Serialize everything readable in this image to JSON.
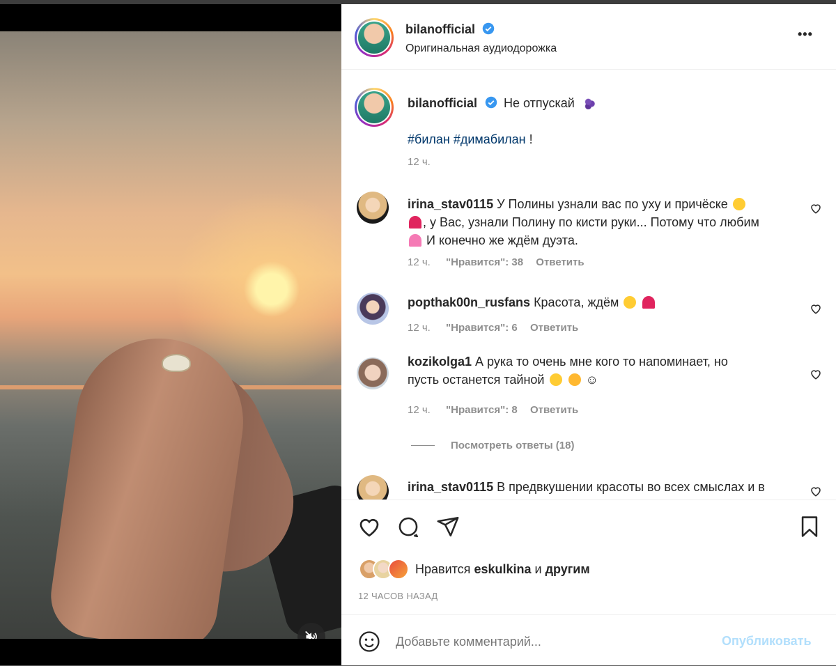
{
  "post": {
    "username": "bilanofficial",
    "audio_label": "Оригинальная аудиодорожка",
    "more_label": "•••"
  },
  "caption": {
    "username": "bilanofficial",
    "text": "Не отпускай",
    "hashtags": "#билан #димабилан",
    "suffix": " !",
    "time": "12 ч."
  },
  "comments": [
    {
      "username": "irina_stav0115",
      "text_part1": "У Полины узнали вас по уху и причёске",
      "text_part2": ", у Вас, узнали Полину по кисти руки... Потому что любим",
      "text_part3": "И конечно же ждём дуэта.",
      "time": "12 ч.",
      "likes": "\"Нравится\": 38",
      "reply": "Ответить"
    },
    {
      "username": "popthak00n_rusfans",
      "text": "Красота, ждём",
      "time": "12 ч.",
      "likes": "\"Нравится\": 6",
      "reply": "Ответить"
    },
    {
      "username": "kozikolga1",
      "text_part1": "А рука то очень мне кого то напоминает, но",
      "text_part2": "пусть останется тайной",
      "text_part3": "☺",
      "time": "12 ч.",
      "likes": "\"Нравится\": 8",
      "reply": "Ответить"
    },
    {
      "username": "irina_stav0115",
      "text": "В предвкушении красоты во всех смыслах и в"
    }
  ],
  "view_replies": "Посмотреть ответы (18)",
  "likes_line": {
    "prefix": "Нравится",
    "user": "eskulkina",
    "and": "и",
    "others": "другим"
  },
  "timestamp": "12 ЧАСОВ НАЗАД",
  "comment_input": {
    "placeholder": "Добавьте комментарий...",
    "publish_label": "Опубликовать"
  },
  "colors": {
    "link": "#00376b",
    "publish": "#b2dffc",
    "verified": "#3897f0"
  }
}
